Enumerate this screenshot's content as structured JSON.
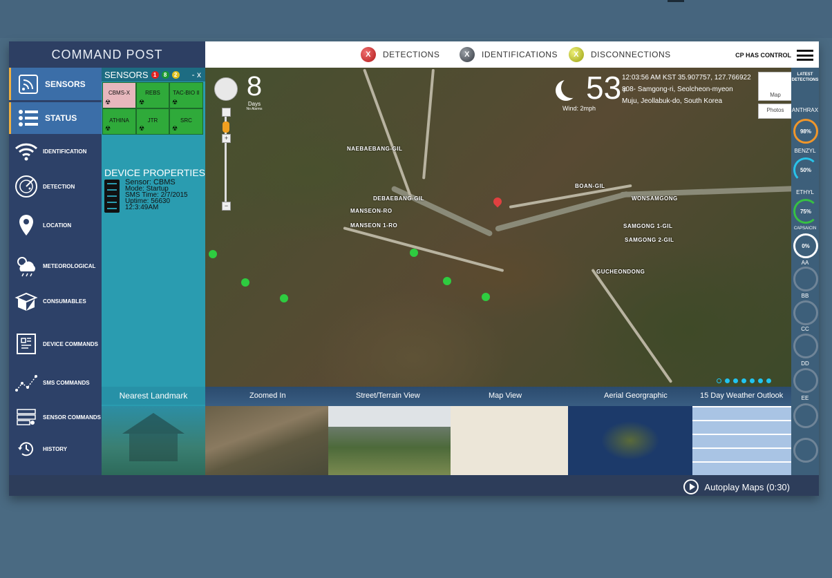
{
  "app": {
    "title": "COMMAND POST"
  },
  "header": {
    "statuses": [
      {
        "label": "DETECTIONS",
        "color": "#d32a2a",
        "mark": "X"
      },
      {
        "label": "IDENTIFICATIONS",
        "color": "#555a60",
        "mark": "X"
      },
      {
        "label": "DISCONNECTIONS",
        "color": "#c8d41e",
        "mark": "X"
      }
    ],
    "control_text": "CP HAS CONTROL"
  },
  "nav": {
    "items": [
      {
        "label": "SENSORS",
        "icon": "sensors-icon",
        "active": true
      },
      {
        "label": "STATUS",
        "icon": "status-list-icon",
        "active": true
      },
      {
        "label": "IDENTIFICATION",
        "icon": "wifi-icon"
      },
      {
        "label": "DETECTION",
        "icon": "radar-icon"
      },
      {
        "label": "LOCATION",
        "icon": "location-pin-icon"
      },
      {
        "label": "METEOROLOGICAL",
        "icon": "weather-icon"
      },
      {
        "label": "CONSUMABLES",
        "icon": "box-icon"
      },
      {
        "label": "DEVICE COMMANDS",
        "icon": "device-icon"
      },
      {
        "label": "SMS COMMANDS",
        "icon": "sms-icon"
      },
      {
        "label": "SENSOR COMMANDS",
        "icon": "server-icon"
      },
      {
        "label": "HISTORY",
        "icon": "history-icon"
      }
    ]
  },
  "sensors_panel": {
    "title": "SENSORS",
    "badges": [
      {
        "value": "1",
        "color": "#e02020"
      },
      {
        "value": "8",
        "color": "#1a9a30"
      },
      {
        "value": "2",
        "color": "#e0c020"
      }
    ],
    "controls": "- x",
    "cells": [
      {
        "label": "CBMS-X",
        "state": "alert"
      },
      {
        "label": "REBS",
        "state": "ok"
      },
      {
        "label": "TAC-BIO II",
        "state": "ok"
      },
      {
        "label": "ATHINA",
        "state": "ok"
      },
      {
        "label": "JTR",
        "state": "ok"
      },
      {
        "label": "SRC",
        "state": "ok"
      }
    ],
    "device_properties_title": "DEVICE PROPERTIES",
    "device": {
      "sensor": "Sensor: CBMS",
      "mode": "Mode: Startup",
      "sms_time": "SMS Time: 2/7/2015",
      "uptime": "Uptime: 56630",
      "time": "12:3:49AM"
    },
    "nearest_landmark": "Nearest Landmark"
  },
  "map": {
    "days_count": "8",
    "days_label": "Days",
    "days_sub": "No Alarms",
    "temperature": "53",
    "temperature_unit": "F",
    "wind": "Wind: 2mph",
    "location_line1": "12:03:56 AM KST 35.907757, 127.766922",
    "location_line2": "808- Samgong-ri, Seolcheon-myeon",
    "location_line3": "Muju, Jeollabuk-do, South Korea",
    "map_button": "Map",
    "photos_button": "Photos",
    "place_names": [
      "NAEBAEBANG-GIL",
      "DEBAEBANG-GIL",
      "MANSEON-RO",
      "MANSEON 1-RO",
      "BOAN-GIL",
      "WONSAMGONG",
      "SAMGONG 1-GIL",
      "SAMGONG 2-GIL",
      "GUCHEONDONG"
    ]
  },
  "thumbnails": [
    {
      "label": "Zoomed In"
    },
    {
      "label": "Street/Terrain View"
    },
    {
      "label": "Map View"
    },
    {
      "label": "Aerial Georgraphic"
    },
    {
      "label": "15 Day Weather Outlook"
    }
  ],
  "right_panel": {
    "header": "LATEST DETECTIONS",
    "gauges": [
      {
        "label": "ANTHRAX",
        "value": "98%",
        "color": "#f0962a"
      },
      {
        "label": "BENZYL",
        "value": "50%",
        "color": "#29c3e8"
      },
      {
        "label": "ETHYL",
        "value": "75%",
        "color": "#37c043"
      },
      {
        "label": "CAPSAICIN",
        "value": "0%",
        "color": "#ffffff"
      },
      {
        "label": "AA",
        "value": ""
      },
      {
        "label": "BB",
        "value": ""
      },
      {
        "label": "CC",
        "value": ""
      },
      {
        "label": "DD",
        "value": ""
      },
      {
        "label": "EE",
        "value": ""
      }
    ]
  },
  "footer": {
    "autoplay": "Autoplay Maps (0:30)"
  }
}
